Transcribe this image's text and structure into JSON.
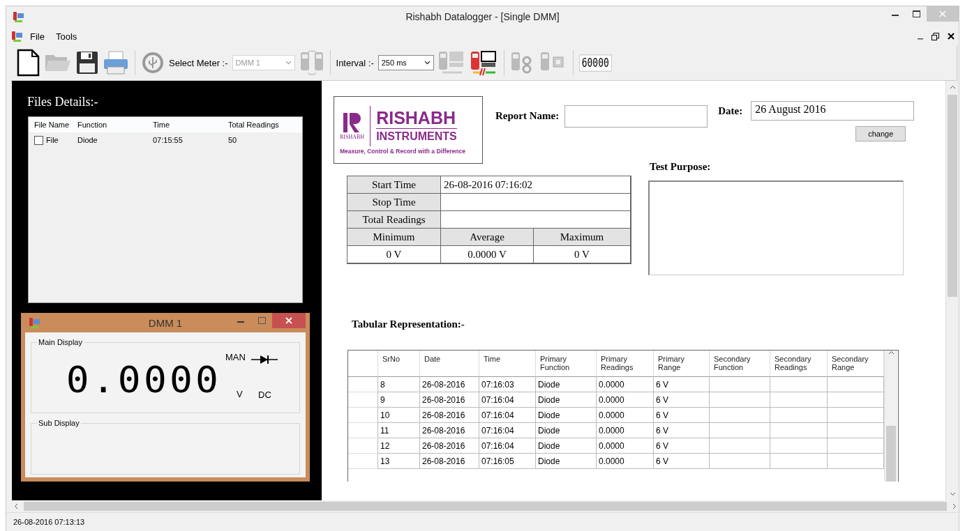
{
  "window": {
    "title": "Rishabh Datalogger - [Single DMM]"
  },
  "menu": [
    "File",
    "Tools"
  ],
  "toolbar": {
    "select_meter_label": "Select Meter :-",
    "meter": "DMM 1",
    "meter_disabled": true,
    "interval_label": "Interval :-",
    "interval": "250 ms",
    "count": "60000"
  },
  "files_panel": {
    "title": "Files Details:-",
    "columns": [
      "File Name",
      "Function",
      "Time",
      "Total Readings"
    ],
    "rows": [
      {
        "checked": false,
        "file_name": "File",
        "function": "Diode",
        "time": "07:15:55",
        "total_readings": "50"
      }
    ]
  },
  "dmm_window": {
    "title": "DMM 1",
    "main_display": {
      "label": "Main Display",
      "value": "0.0000",
      "mode": "MAN",
      "unit": "V",
      "coupling": "DC"
    },
    "sub_display": {
      "label": "Sub Display"
    }
  },
  "report": {
    "logo": {
      "name": "RISHABH",
      "sub": "INSTRUMENTS",
      "small": "RISHABH",
      "tagline": "Measure, Control & Record with a Difference"
    },
    "report_name_label": "Report Name:",
    "date_label": "Date:",
    "date": "26 August 2016",
    "change_button": "change",
    "test_purpose_label": "Test Purpose:",
    "summary": {
      "rows": [
        {
          "label": "Start Time",
          "value": "26-08-2016 07:16:02"
        },
        {
          "label": "Stop Time",
          "value": ""
        },
        {
          "label": "Total Readings",
          "value": ""
        }
      ],
      "stat_labels": [
        "Minimum",
        "Average",
        "Maximum"
      ],
      "stat_values": [
        "0 V",
        "0.0000 V",
        "0 V"
      ]
    },
    "tabular_title": "Tabular Representation:-",
    "table": {
      "columns": [
        "SrNo",
        "Date",
        "Time",
        "Primary Function",
        "Primary Readings",
        "Primary Range",
        "Secondary Function",
        "Secondary Readings",
        "Secondary Range"
      ],
      "rows": [
        [
          "8",
          "26-08-2016",
          "07:16:03",
          "Diode",
          "0.0000",
          "6 V",
          "",
          "",
          ""
        ],
        [
          "9",
          "26-08-2016",
          "07:16:04",
          "Diode",
          "0.0000",
          "6 V",
          "",
          "",
          ""
        ],
        [
          "10",
          "26-08-2016",
          "07:16:04",
          "Diode",
          "0.0000",
          "6 V",
          "",
          "",
          ""
        ],
        [
          "11",
          "26-08-2016",
          "07:16:04",
          "Diode",
          "0.0000",
          "6 V",
          "",
          "",
          ""
        ],
        [
          "12",
          "26-08-2016",
          "07:16:04",
          "Diode",
          "0.0000",
          "6 V",
          "",
          "",
          ""
        ],
        [
          "13",
          "26-08-2016",
          "07:16:05",
          "Diode",
          "0.0000",
          "6 V",
          "",
          "",
          ""
        ]
      ]
    }
  },
  "status_bar": "26-08-2016 07:13:13"
}
